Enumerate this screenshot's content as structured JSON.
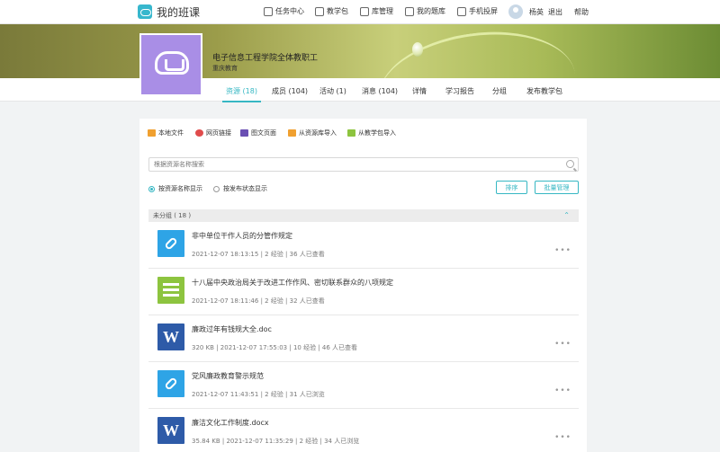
{
  "app": {
    "title": "我的班课",
    "nav": [
      {
        "label": "任务中心",
        "icon": "task-icon"
      },
      {
        "label": "教学包",
        "icon": "package-icon"
      },
      {
        "label": "库管理",
        "icon": "library-icon"
      },
      {
        "label": "我的题库",
        "icon": "question-bank-icon"
      },
      {
        "label": "手机投屏",
        "icon": "screen-cast-icon"
      }
    ],
    "user_name": "杨英",
    "logout_label": "退出",
    "help_label": "帮助"
  },
  "class": {
    "name": "电子信息工程学院全体教职工",
    "school": "重庆教育"
  },
  "tabs": [
    {
      "label": "资源 (18)",
      "active": true
    },
    {
      "label": "成员 (104)",
      "active": false
    },
    {
      "label": "活动 (1)",
      "active": false
    },
    {
      "label": "消息 (104)",
      "active": false
    },
    {
      "label": "详情",
      "active": false
    },
    {
      "label": "学习报告",
      "active": false
    },
    {
      "label": "分组",
      "active": false
    },
    {
      "label": "发布教学包",
      "active": false
    }
  ],
  "actions": [
    {
      "label": "本地文件",
      "icon": "folder-icon",
      "color": "#f0a030"
    },
    {
      "label": "网页链接",
      "icon": "link-icon",
      "color": "#e04b4b"
    },
    {
      "label": "图文页面",
      "icon": "page-icon",
      "color": "#6a4fb3"
    },
    {
      "label": "从资源库导入",
      "icon": "import-icon",
      "color": "#f0a030"
    },
    {
      "label": "从教学包导入",
      "icon": "package-import-icon",
      "color": "#8dc43f"
    }
  ],
  "search": {
    "placeholder": "根据资源名称搜索"
  },
  "view_options": [
    {
      "label": "按资源名称显示",
      "selected": true
    },
    {
      "label": "按发布状态显示",
      "selected": false
    }
  ],
  "buttons": {
    "sort": "排序",
    "batch": "批量管理"
  },
  "folder": {
    "label": "未分组 ( 18 )"
  },
  "files": [
    {
      "type": "link",
      "title": "非中单位干作人员的分管作规定",
      "meta": "2021-12-07 18:13:15  |  2 经验  |  36 人已查看"
    },
    {
      "type": "page",
      "title": "十八届中央政治局关于改进工作作风、密切联系群众的八项规定",
      "meta": "2021-12-07 18:11:46  |  2 经验  |  32 人已查看"
    },
    {
      "type": "doc",
      "title": "廉政过年有钱规大全.doc",
      "meta": "320 KB  |  2021-12-07 17:55:03  |  10 经验  |  46 人已查看"
    },
    {
      "type": "link",
      "title": "党风廉政教育警示规范",
      "meta": "2021-12-07 11:43:51  |  2 经验  |  31 人已浏览"
    },
    {
      "type": "doc",
      "title": "廉洁文化工作制度.docx",
      "meta": "35.84 KB  |  2021-12-07 11:35:29  |  2 经验  |  34 人已浏览"
    }
  ]
}
